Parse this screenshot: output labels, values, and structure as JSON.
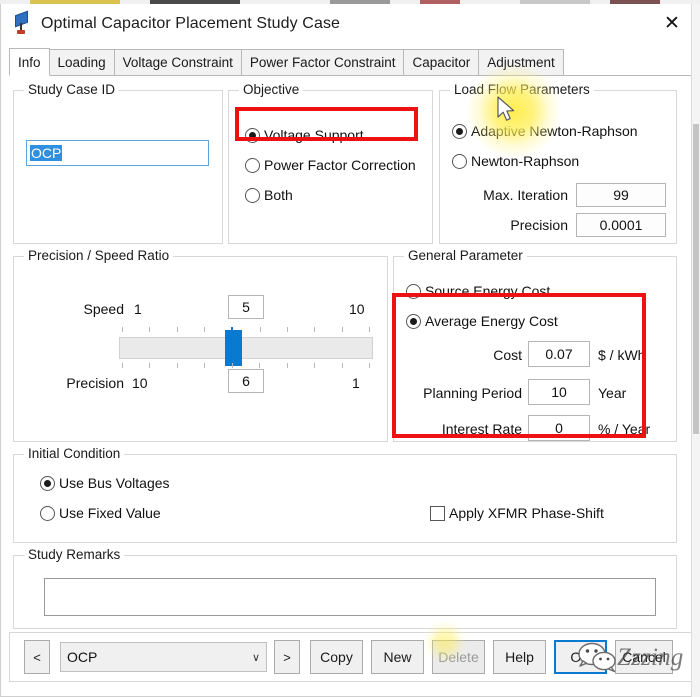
{
  "window": {
    "title": "Optimal Capacitor Placement Study Case",
    "icon": "capacitor-icon",
    "close_label": "✕"
  },
  "tabs": [
    {
      "label": "Info",
      "active": true
    },
    {
      "label": "Loading",
      "active": false
    },
    {
      "label": "Voltage Constraint",
      "active": false
    },
    {
      "label": "Power Factor Constraint",
      "active": false
    },
    {
      "label": "Capacitor",
      "active": false
    },
    {
      "label": "Adjustment",
      "active": false
    }
  ],
  "study_case_id": {
    "legend": "Study Case ID",
    "value": "OCP",
    "selected": true
  },
  "objective": {
    "legend": "Objective",
    "options": [
      {
        "label": "Voltage Support",
        "selected": true,
        "highlighted": true
      },
      {
        "label": "Power Factor Correction",
        "selected": false,
        "highlighted": false
      },
      {
        "label": "Both",
        "selected": false,
        "highlighted": false
      }
    ]
  },
  "load_flow_parameters": {
    "legend": "Load Flow Parameters",
    "methods": [
      {
        "label": "Adaptive Newton-Raphson",
        "selected": true
      },
      {
        "label": "Newton-Raphson",
        "selected": false
      }
    ],
    "fields": [
      {
        "label": "Max. Iteration",
        "value": "99"
      },
      {
        "label": "Precision",
        "value": "0.0001"
      }
    ]
  },
  "precision_speed_ratio": {
    "legend": "Precision / Speed Ratio",
    "speed": {
      "label": "Speed",
      "min_label": "1",
      "max_label": "10",
      "value": "5"
    },
    "precision": {
      "label": "Precision",
      "min_label": "10",
      "max_label": "1",
      "value": "6"
    },
    "slider": {
      "position_percent": 44,
      "tick_count": 10,
      "active_tick_index": 4
    }
  },
  "general_parameter": {
    "legend": "General Parameter",
    "options": [
      {
        "label": "Source Energy Cost",
        "selected": false
      },
      {
        "label": "Average Energy Cost",
        "selected": true
      }
    ],
    "highlighted": true,
    "fields": [
      {
        "label": "Cost",
        "value": "0.07",
        "unit": "$ / kWh"
      },
      {
        "label": "Planning Period",
        "value": "10",
        "unit": "Year"
      },
      {
        "label": "Interest Rate",
        "value": "0",
        "unit": "% / Year"
      }
    ]
  },
  "initial_condition": {
    "legend": "Initial Condition",
    "options": [
      {
        "label": "Use Bus Voltages",
        "selected": true
      },
      {
        "label": "Use Fixed Value",
        "selected": false
      }
    ],
    "checkbox": {
      "label": "Apply XFMR Phase-Shift",
      "checked": false
    }
  },
  "study_remarks": {
    "legend": "Study Remarks",
    "value": "",
    "placeholder": ""
  },
  "bottom_bar": {
    "prev_label": "<",
    "next_label": ">",
    "combo": {
      "value": "OCP",
      "arrow": "∨"
    },
    "buttons": [
      {
        "label": "Copy",
        "disabled": false,
        "default": false
      },
      {
        "label": "New",
        "disabled": false,
        "default": false
      },
      {
        "label": "Delete",
        "disabled": true,
        "default": false
      },
      {
        "label": "Help",
        "disabled": false,
        "default": false
      },
      {
        "label": "OK",
        "disabled": false,
        "default": true
      },
      {
        "label": "Cancel",
        "disabled": false,
        "default": false
      }
    ]
  },
  "watermark": {
    "text": "Zzzing",
    "icon": "wechat-logo"
  },
  "colors": {
    "accent": "#0a7ad0",
    "annotation": "#ee1111",
    "selection": "#2f8fe0",
    "highlight_glow": "#ffec40"
  }
}
